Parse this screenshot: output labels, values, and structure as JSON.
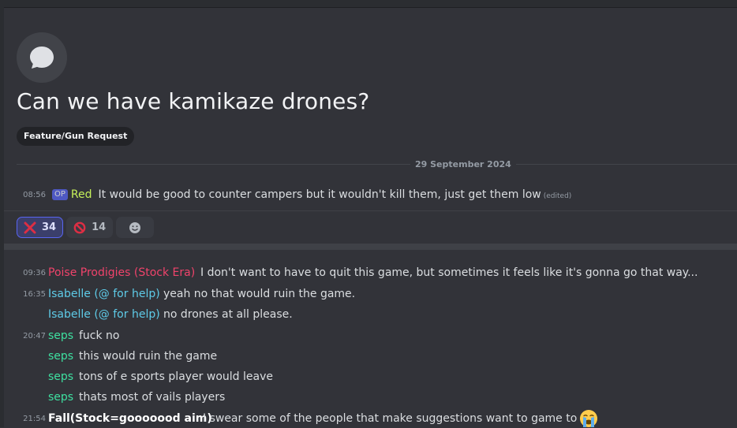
{
  "thread": {
    "title": "Can we have kamikaze drones?",
    "tag": "Feature/Gun Request",
    "date": "29 September 2024"
  },
  "op_message": {
    "time": "08:56",
    "badge": "OP",
    "author": "Red",
    "text": "It would be good to counter campers but it wouldn't kill them, just get them low",
    "edited": "(edited)"
  },
  "reactions": [
    {
      "icon": "cross-mark-icon",
      "count": "34"
    },
    {
      "icon": "prohibited-icon",
      "count": "14"
    },
    {
      "icon": "add-reaction-icon",
      "count": ""
    }
  ],
  "messages": [
    {
      "time": "09:36",
      "author": "Poise Prodigies (Stock Era)",
      "color": "#f0436b",
      "text": "I don't want to have to quit this game, but sometimes it feels like it's gonna go that way..."
    },
    {
      "time": "16:35",
      "author": "Isabelle (@ for help)",
      "color": "#5ecbe8",
      "text": "yeah no that would ruin the game."
    },
    {
      "time": "",
      "author": "Isabelle (@ for help)",
      "color": "#5ecbe8",
      "text": "no drones at all please."
    },
    {
      "time": "20:47",
      "author": "seps",
      "color": "#3ee0a0",
      "text": "fuck no"
    },
    {
      "time": "",
      "author": "seps",
      "color": "#3ee0a0",
      "text": "this would ruin the game"
    },
    {
      "time": "",
      "author": "seps",
      "color": "#3ee0a0",
      "text": "tons of e sports player would leave"
    },
    {
      "time": "",
      "author": "seps",
      "color": "#3ee0a0",
      "text": "thats most of vails players"
    },
    {
      "time": "21:54",
      "author": "Fall(Stock=gooooood aim)",
      "color": "#ffffff",
      "text": "I swear some of the people that make suggestions want to game to die",
      "emoji": "loudly-crying-face-icon"
    }
  ]
}
